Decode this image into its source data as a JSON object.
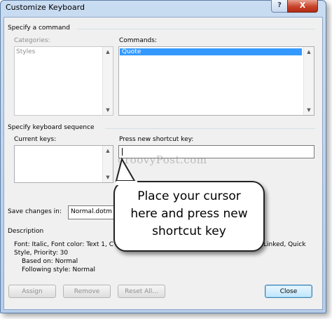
{
  "window": {
    "title": "Customize Keyboard",
    "help_glyph": "?",
    "close_glyph": "X"
  },
  "command_section": {
    "title": "Specify a command",
    "categories_label": "Categories:",
    "categories": [
      "Styles"
    ],
    "commands_label": "Commands:",
    "commands": [
      "Quote"
    ],
    "selected_command": "Quote"
  },
  "sequence_section": {
    "title": "Specify keyboard sequence",
    "current_keys_label": "Current keys:",
    "current_keys": [],
    "new_shortcut_label": "Press new shortcut key:",
    "new_shortcut_value": ""
  },
  "save_changes": {
    "label": "Save changes in:",
    "value": "Normal.dotm"
  },
  "description": {
    "title": "Description",
    "line1_left": "Font: Italic, Font color: Text 1, C",
    "line1_right": "Linked, Quick",
    "line2": "Style, Priority: 30",
    "line3": "Based on: Normal",
    "line4": "Following style: Normal"
  },
  "buttons": {
    "assign": "Assign",
    "remove": "Remove",
    "reset_all": "Reset All...",
    "close": "Close"
  },
  "callout": {
    "line1": "Place your cursor",
    "line2": "here and press new",
    "line3": "shortcut key"
  },
  "watermark": "groovyPost.com",
  "icons": {
    "scroll_up": "up-arrow-icon",
    "scroll_down": "down-arrow-icon",
    "dropdown": "chevron-down-icon"
  },
  "colors": {
    "selection": "#3399ff",
    "title_bar": "#c9dcf1",
    "close_button": "#c8432b"
  }
}
